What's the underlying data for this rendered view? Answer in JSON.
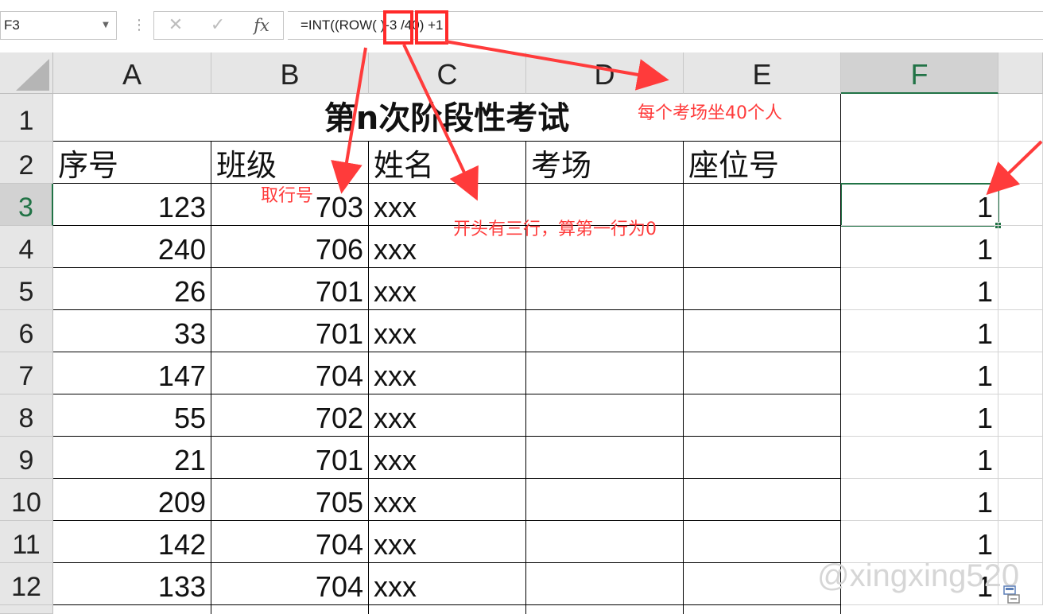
{
  "name_box": {
    "value": "F3"
  },
  "formula_bar": {
    "cancel_icon": "✕",
    "enter_icon": "✓",
    "fx_label": "fx",
    "formula": "=INT((ROW( )-3 /40) +1"
  },
  "columns": [
    "A",
    "B",
    "C",
    "D",
    "E",
    "F"
  ],
  "rows": [
    "1",
    "2",
    "3",
    "4",
    "5",
    "6",
    "7",
    "8",
    "9",
    "10",
    "11",
    "12"
  ],
  "sheet": {
    "title": "第n次阶段性考试",
    "headers": [
      "序号",
      "班级",
      "姓名",
      "考场",
      "座位号"
    ],
    "data": [
      {
        "seq": "123",
        "cls": "703",
        "name": "xxx",
        "f": "1"
      },
      {
        "seq": "240",
        "cls": "706",
        "name": "xxx",
        "f": "1"
      },
      {
        "seq": "26",
        "cls": "701",
        "name": "xxx",
        "f": "1"
      },
      {
        "seq": "33",
        "cls": "701",
        "name": "xxx",
        "f": "1"
      },
      {
        "seq": "147",
        "cls": "704",
        "name": "xxx",
        "f": "1"
      },
      {
        "seq": "55",
        "cls": "702",
        "name": "xxx",
        "f": "1"
      },
      {
        "seq": "21",
        "cls": "701",
        "name": "xxx",
        "f": "1"
      },
      {
        "seq": "209",
        "cls": "705",
        "name": "xxx",
        "f": "1"
      },
      {
        "seq": "142",
        "cls": "704",
        "name": "xxx",
        "f": "1"
      },
      {
        "seq": "133",
        "cls": "704",
        "name": "xxx",
        "f": "1"
      }
    ]
  },
  "annotations": {
    "row_label": "取行号",
    "offset_label": "开头有三行，算第一行为0",
    "per_room_label": "每个考场坐40个人",
    "color": "#ff3b3b"
  },
  "watermark": "@xingxing520",
  "colors": {
    "selection": "#217346",
    "header_bg": "#e6e6e6"
  }
}
